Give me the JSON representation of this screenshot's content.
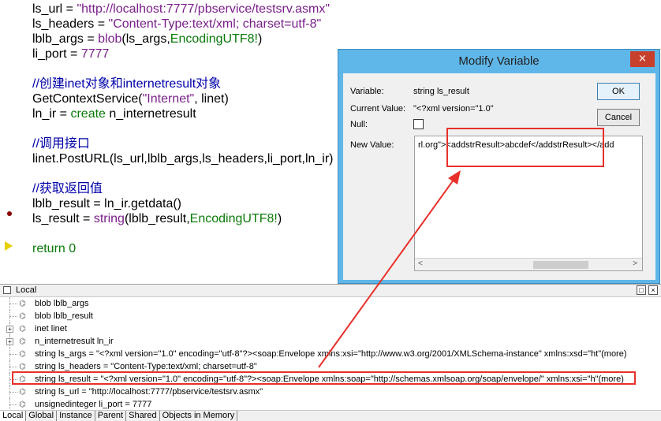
{
  "editor": {
    "lines": [
      {
        "a": "ls_url = ",
        "b": "\"http://localhost:7777/pbservice/testsrv.asmx\""
      },
      {
        "a": "ls_headers = ",
        "b": "\"Content-Type:text/xml; charset=utf-8\""
      },
      {
        "a": "lblb_args = ",
        "fn": "blob",
        "c": "(ls_args,",
        "k": "EncodingUTF8!",
        "d": ")"
      },
      {
        "a": "li_port = ",
        "n": "7777"
      },
      {
        "comment": "//创建inet对象和internetresult对象"
      },
      {
        "a": "GetContextService(",
        "b": "\"Internet\"",
        "c": ", linet)"
      },
      {
        "a": "ln_ir = ",
        "k": "create",
        "c": " n_internetresult"
      },
      {
        "comment": "//调用接口"
      },
      {
        "a": "linet.PostURL(ls_url,lblb_args,ls_headers,li_port,ln_ir)"
      },
      {
        "comment": "//获取返回值"
      },
      {
        "a": "lblb_result = ln_ir.getdata()"
      },
      {
        "a": "ls_result = ",
        "fn": "string",
        "c": "(lblb_result,",
        "k": "EncodingUTF8!",
        "d": ")"
      },
      {
        "ret": "return",
        "n": " 0"
      }
    ]
  },
  "local_pane": {
    "title": "Local",
    "items": [
      {
        "text": "blob lblb_args",
        "expand": false
      },
      {
        "text": "blob lblb_result",
        "expand": false
      },
      {
        "text": "inet linet",
        "expand": true
      },
      {
        "text": "n_internetresult ln_ir",
        "expand": true
      },
      {
        "text": "string ls_args = \"<?xml version=\"1.0\" encoding=\"utf-8\"?><soap:Envelope xmlns:xsi=\"http://www.w3.org/2001/XMLSchema-instance\" xmlns:xsd=\"ht\"(more)",
        "expand": false
      },
      {
        "text": "string ls_headers = \"Content-Type:text/xml; charset=utf-8\"",
        "expand": false
      },
      {
        "text": "string ls_result = \"<?xml version=\"1.0\" encoding=\"utf-8\"?><soap:Envelope xmlns:soap=\"http://schemas.xmlsoap.org/soap/envelope/\" xmlns:xsi=\"h\"(more)",
        "expand": false
      },
      {
        "text": "string ls_url = \"http://localhost:7777/pbservice/testsrv.asmx\"",
        "expand": false
      },
      {
        "text": "unsignedinteger li_port = 7777",
        "expand": false
      }
    ],
    "tabs": [
      "Local",
      "Global",
      "Instance",
      "Parent",
      "Shared",
      "Objects in Memory"
    ]
  },
  "dialog": {
    "title": "Modify Variable",
    "close": "×",
    "variable_label": "Variable:",
    "variable_value": "string ls_result",
    "current_label": "Current Value:",
    "current_value": "\"<?xml version=\"1.0\"",
    "null_label": "Null:",
    "new_label": "New Value:",
    "new_value": "rl.org\"><addstrResult>abcdef</addstrResult></add",
    "ok": "OK",
    "cancel": "Cancel"
  },
  "colors": {
    "highlight": "#e8302a",
    "dialog_frame": "#5fb6e8"
  }
}
